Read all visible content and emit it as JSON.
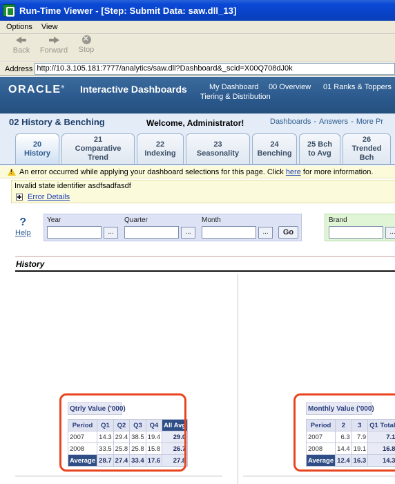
{
  "window": {
    "title": "Run-Time Viewer - [Step: Submit Data: saw.dll_13]"
  },
  "menu": {
    "options": "Options",
    "view": "View"
  },
  "toolbar": {
    "back": "Back",
    "forward": "Forward",
    "stop": "Stop"
  },
  "address": {
    "label": "Address",
    "url": "http://10.3.105.181:7777/analytics/saw.dll?Dashboard&_scid=X00Q708dJ0k"
  },
  "header": {
    "logo": "ORACLE",
    "product": "Interactive Dashboards",
    "nav": [
      "My Dashboard",
      "00 Overview",
      "01 Ranks & Toppers",
      "Tiering & Distribution"
    ]
  },
  "dashbar": {
    "page": "02 History & Benching",
    "welcome": "Welcome, Administrator!",
    "links": [
      "Dashboards",
      "Answers",
      "More Pr"
    ]
  },
  "tabs": [
    {
      "l1": "20",
      "l2": "History",
      "l3": ""
    },
    {
      "l1": "21",
      "l2": "Comparative",
      "l3": "Trend"
    },
    {
      "l1": "22",
      "l2": "Indexing",
      "l3": ""
    },
    {
      "l1": "23",
      "l2": "Seasonality",
      "l3": ""
    },
    {
      "l1": "24",
      "l2": "Benching",
      "l3": ""
    },
    {
      "l1": "25 Bch",
      "l2": "to Avg",
      "l3": ""
    },
    {
      "l1": "26",
      "l2": "Trended",
      "l3": "Bch"
    }
  ],
  "error": {
    "text_before": "An error occurred while applying your dashboard selections for this page. Click ",
    "link": "here",
    "text_after": " for more information.",
    "message": "Invalid state identifier asdfsadfasdf",
    "details": "Error Details"
  },
  "prompts": {
    "help_symbol": "?",
    "help": "Help",
    "year": "Year",
    "quarter": "Quarter",
    "month": "Month",
    "dots": "...",
    "go": "Go",
    "brand": "Brand"
  },
  "section": {
    "title": "History"
  },
  "qtrly": {
    "caption": "Qtrly Value ('000)",
    "headers": [
      "Period",
      "Q1",
      "Q2",
      "Q3",
      "Q4",
      "All Avg"
    ],
    "rows": [
      [
        "2007",
        "14.3",
        "29.4",
        "38.5",
        "19.4",
        "29.0"
      ],
      [
        "2008",
        "33.5",
        "25.8",
        "25.8",
        "15.8",
        "26.7"
      ],
      [
        "Average",
        "28.7",
        "27.4",
        "33.4",
        "17.6",
        "27.8"
      ]
    ]
  },
  "monthly": {
    "caption": "Monthly Value ('000)",
    "headers": [
      "Period",
      "2",
      "3",
      "Q1 Total"
    ],
    "rows": [
      [
        "2007",
        "6.3",
        "7.9",
        "7.1"
      ],
      [
        "2008",
        "14.4",
        "19.1",
        "16.8"
      ],
      [
        "Average",
        "12.4",
        "16.3",
        "14.3"
      ]
    ]
  },
  "colors": {
    "header": "#2c5a8e",
    "highlight": "#e8451f",
    "table_dark": "#2f4e86"
  }
}
